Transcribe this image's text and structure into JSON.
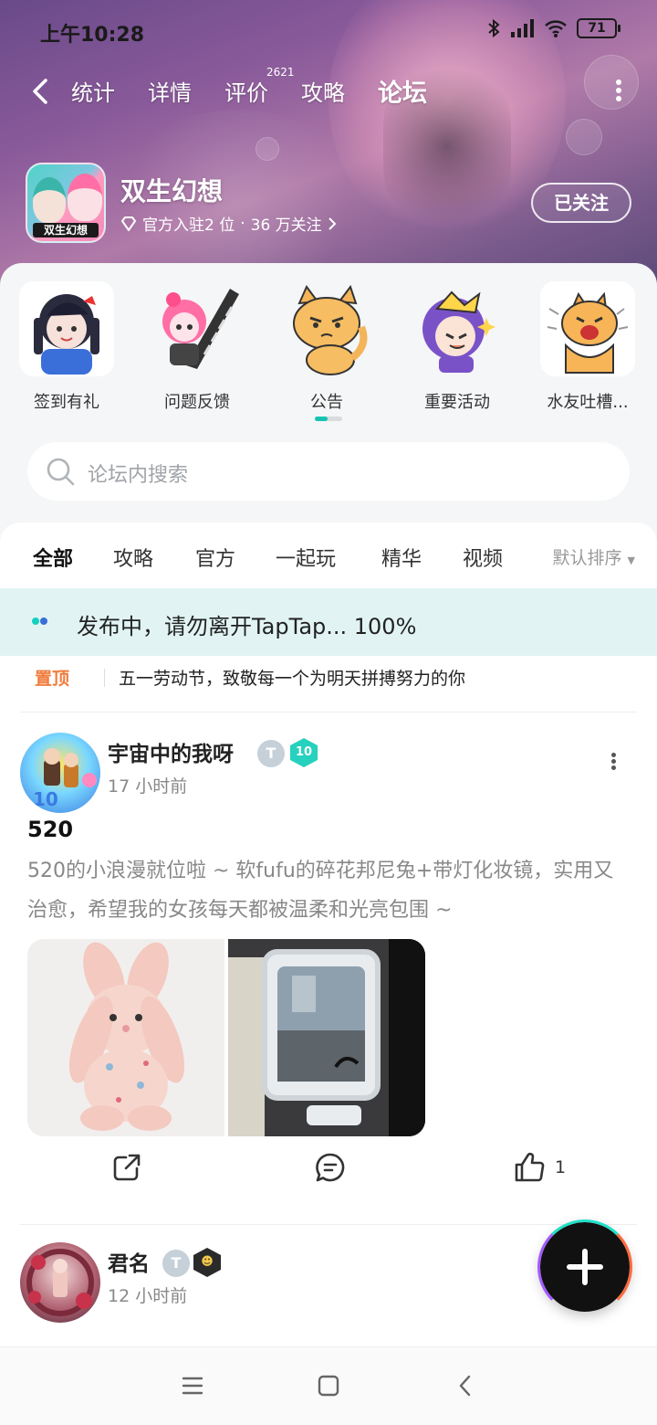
{
  "status_bar": {
    "time": "上午10:28",
    "battery": "71"
  },
  "nav": {
    "tabs": [
      {
        "label": "统计"
      },
      {
        "label": "详情"
      },
      {
        "label": "评价",
        "badge": "2621"
      },
      {
        "label": "攻略"
      },
      {
        "label": "论坛",
        "active": true
      }
    ]
  },
  "game": {
    "title": "双生幻想",
    "icon_text": "双生幻想",
    "official": "官方入驻2 位",
    "followers": "36 万关注",
    "follow_button": "已关注"
  },
  "sections": [
    {
      "label": "签到有礼"
    },
    {
      "label": "问题反馈"
    },
    {
      "label": "公告"
    },
    {
      "label": "重要活动"
    },
    {
      "label": "水友吐槽..."
    }
  ],
  "search": {
    "placeholder": "论坛内搜索"
  },
  "filters": {
    "tabs": [
      "全部",
      "攻略",
      "官方",
      "一起玩",
      "精华",
      "视频"
    ],
    "sort": "默认排序"
  },
  "publishing": {
    "text": "发布中，请勿离开TapTap... 100%"
  },
  "pinned": {
    "tag": "置顶",
    "text": "五一劳动节，致敬每一个为明天拼搏努力的你"
  },
  "posts": [
    {
      "author": "宇宙中的我呀",
      "level": "10",
      "time": "17 小时前",
      "title": "520",
      "body": "520的小浪漫就位啦 ~ 软fufu的碎花邦尼兔+带灯化妆镜，实用又治愈，希望我的女孩每天都被温柔和光亮包围 ~",
      "likes": "1"
    },
    {
      "author": "君名",
      "time": "12 小时前"
    }
  ],
  "colors": {
    "accent": "#14d0bf",
    "pinned": "#f07c3c",
    "publishing_bg": "#e1f4f3"
  }
}
